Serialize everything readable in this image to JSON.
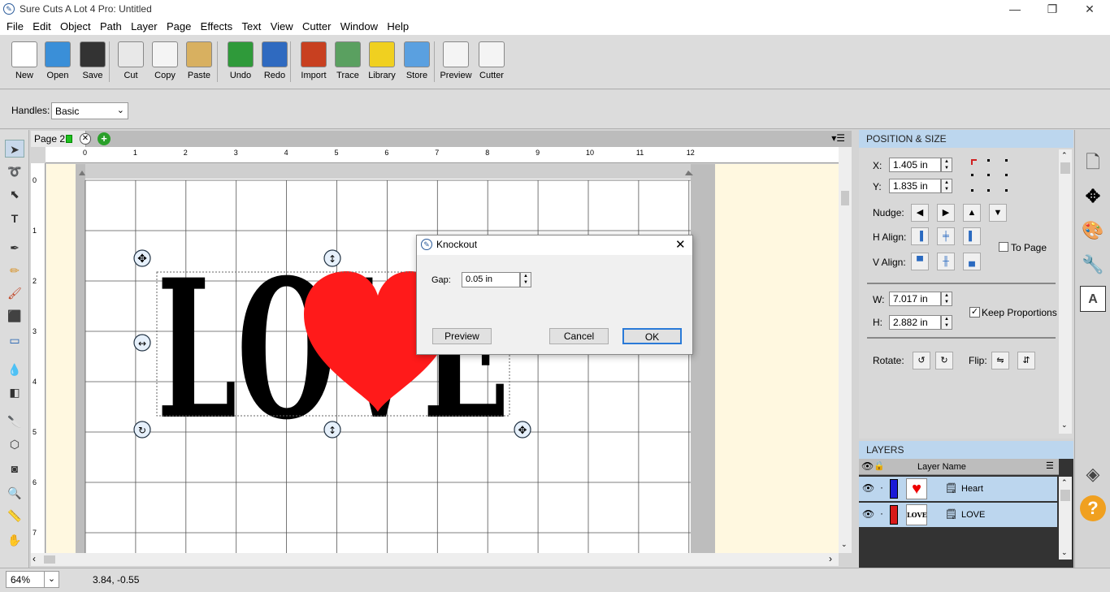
{
  "window": {
    "title": "Sure Cuts A Lot 4 Pro: Untitled",
    "minimize": "—",
    "restore": "❐",
    "close": "✕"
  },
  "menu": [
    "File",
    "Edit",
    "Object",
    "Path",
    "Layer",
    "Page",
    "Effects",
    "Text",
    "View",
    "Cutter",
    "Window",
    "Help"
  ],
  "toolbar": [
    {
      "label": "New",
      "icon": "new-icon",
      "color": "#ffffff"
    },
    {
      "label": "Open",
      "icon": "open-icon",
      "color": "#3a8fd8"
    },
    {
      "label": "Save",
      "icon": "save-icon",
      "color": "#333333"
    },
    {
      "label": "Cut",
      "icon": "cut-icon",
      "color": "#e8e8e8"
    },
    {
      "label": "Copy",
      "icon": "copy-icon",
      "color": "#f4f4f4"
    },
    {
      "label": "Paste",
      "icon": "paste-icon",
      "color": "#d8b060"
    },
    {
      "label": "Undo",
      "icon": "undo-icon",
      "color": "#2f9a3a"
    },
    {
      "label": "Redo",
      "icon": "redo-icon",
      "color": "#2f6ac0"
    },
    {
      "label": "Import",
      "icon": "import-svg-icon",
      "color": "#c84020"
    },
    {
      "label": "Trace",
      "icon": "trace-icon",
      "color": "#5aa060"
    },
    {
      "label": "Library",
      "icon": "library-star-icon",
      "color": "#f0d020"
    },
    {
      "label": "Store",
      "icon": "store-cart-icon",
      "color": "#5aa0e0"
    },
    {
      "label": "Preview",
      "icon": "preview-magnifier-icon",
      "color": "#f4f4f4"
    },
    {
      "label": "Cutter",
      "icon": "cutter-knife-icon",
      "color": "#f4f4f4"
    }
  ],
  "options": {
    "handles_label": "Handles:",
    "handles_value": "Basic"
  },
  "page_tab": {
    "label": "Page 2"
  },
  "ruler_top": [
    "0",
    "1",
    "2",
    "3",
    "4",
    "5",
    "6",
    "7",
    "8",
    "9",
    "10",
    "11",
    "12"
  ],
  "ruler_left": [
    "0",
    "1",
    "2",
    "3",
    "4",
    "5",
    "6",
    "7"
  ],
  "canvas": {
    "word": "LOVE",
    "heart_color": "#ff1a1a"
  },
  "status": {
    "zoom": "64%",
    "coords": "3.84, -0.55"
  },
  "position_size": {
    "header": "POSITION & SIZE",
    "x_label": "X:",
    "x_value": "1.405 in",
    "y_label": "Y:",
    "y_value": "1.835 in",
    "nudge_label": "Nudge:",
    "halign_label": "H Align:",
    "valign_label": "V Align:",
    "to_page": "To Page",
    "w_label": "W:",
    "w_value": "7.017 in",
    "h_label": "H:",
    "h_value": "2.882 in",
    "keep_proportions": "Keep Proportions",
    "rotate_label": "Rotate:",
    "flip_label": "Flip:"
  },
  "layers": {
    "header": "LAYERS",
    "col_name": "Layer Name",
    "items": [
      {
        "name": "Heart",
        "color": "#1a1ad8",
        "thumb": "heart"
      },
      {
        "name": "LOVE",
        "color": "#d81a1a",
        "thumb": "LOVE"
      }
    ]
  },
  "dialog": {
    "title": "Knockout",
    "gap_label": "Gap:",
    "gap_value": "0.05 in",
    "preview": "Preview",
    "cancel": "Cancel",
    "ok": "OK"
  }
}
